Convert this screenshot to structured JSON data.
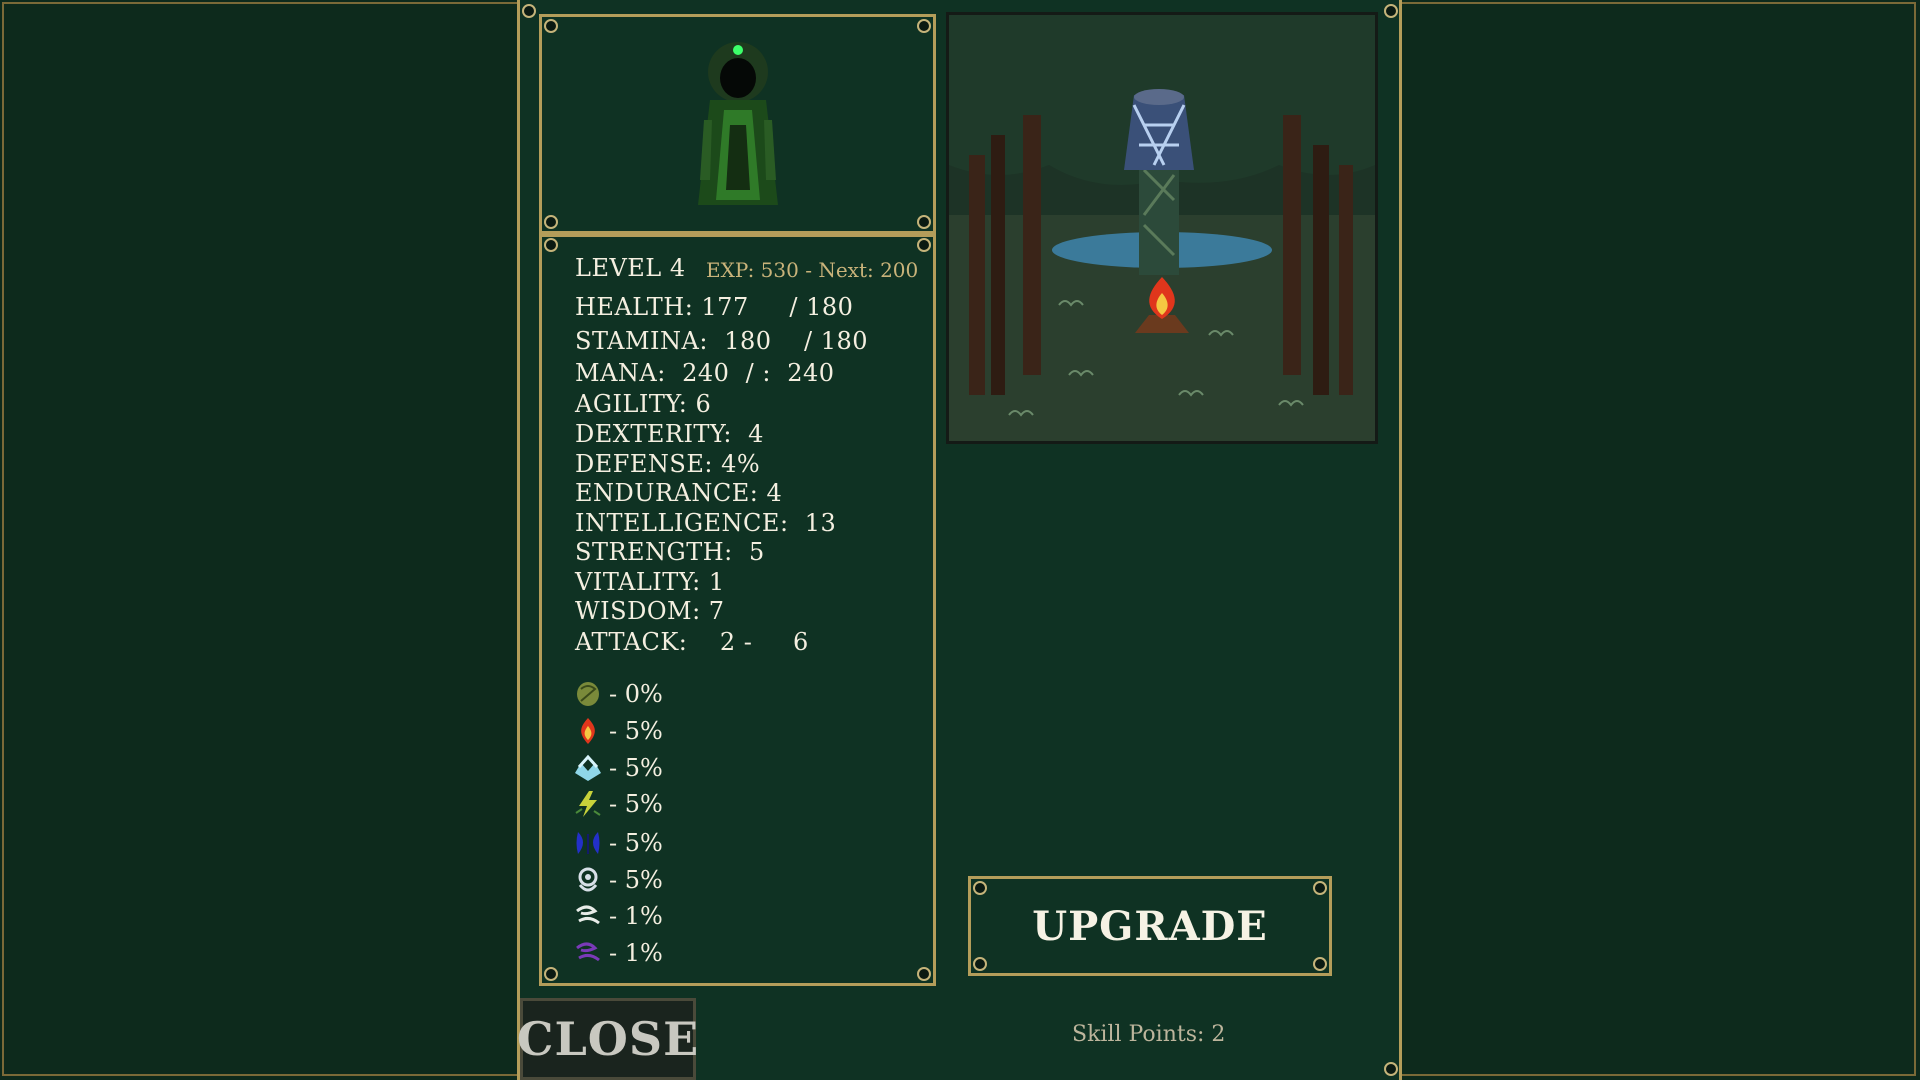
{
  "character": {
    "level_label": "LEVEL 4",
    "exp_label": "EXP: 530 - Next: 200"
  },
  "stats": [
    {
      "text": "HEALTH: 177     / 180"
    },
    {
      "text": "STAMINA:  180    / 180"
    },
    {
      "text": "MANA:  240  / :  240"
    },
    {
      "text": "AGILITY: 6"
    },
    {
      "text": "DEXTERITY:  4"
    },
    {
      "text": "DEFENSE: 4%"
    },
    {
      "text": "ENDURANCE: 4"
    },
    {
      "text": "INTELLIGENCE:  13"
    },
    {
      "text": "STRENGTH:  5"
    },
    {
      "text": "VITALITY: 1"
    },
    {
      "text": "WISDOM: 7"
    },
    {
      "text": "ATTACK:    2 -     6"
    }
  ],
  "resistances": [
    {
      "icon": "nature-resist-icon",
      "value": "- 0%",
      "color": "#7a8a3a"
    },
    {
      "icon": "fire-resist-icon",
      "value": "- 5%",
      "color": "#e0361c"
    },
    {
      "icon": "frost-resist-icon",
      "value": "- 5%",
      "color": "#8fd6e8"
    },
    {
      "icon": "lightning-resist-icon",
      "value": "- 5%",
      "color": "#c8d23a"
    },
    {
      "icon": "water-resist-icon",
      "value": "- 5%",
      "color": "#2330c8"
    },
    {
      "icon": "spirit-resist-icon",
      "value": "- 5%",
      "color": "#d8e0e8"
    },
    {
      "icon": "wind-resist-icon",
      "value": "- 1%",
      "color": "#e8ece8"
    },
    {
      "icon": "shadow-resist-icon",
      "value": "- 1%",
      "color": "#7a3ab8"
    }
  ],
  "buttons": {
    "upgrade_label": "UPGRADE",
    "close_label": "CLOSE"
  },
  "skill_points_label": "Skill Points:  2",
  "colors": {
    "background": "#0d2a1c",
    "panel": "#0f3223",
    "gold_border": "#b49d5a",
    "exp_text": "#c9b37a"
  }
}
